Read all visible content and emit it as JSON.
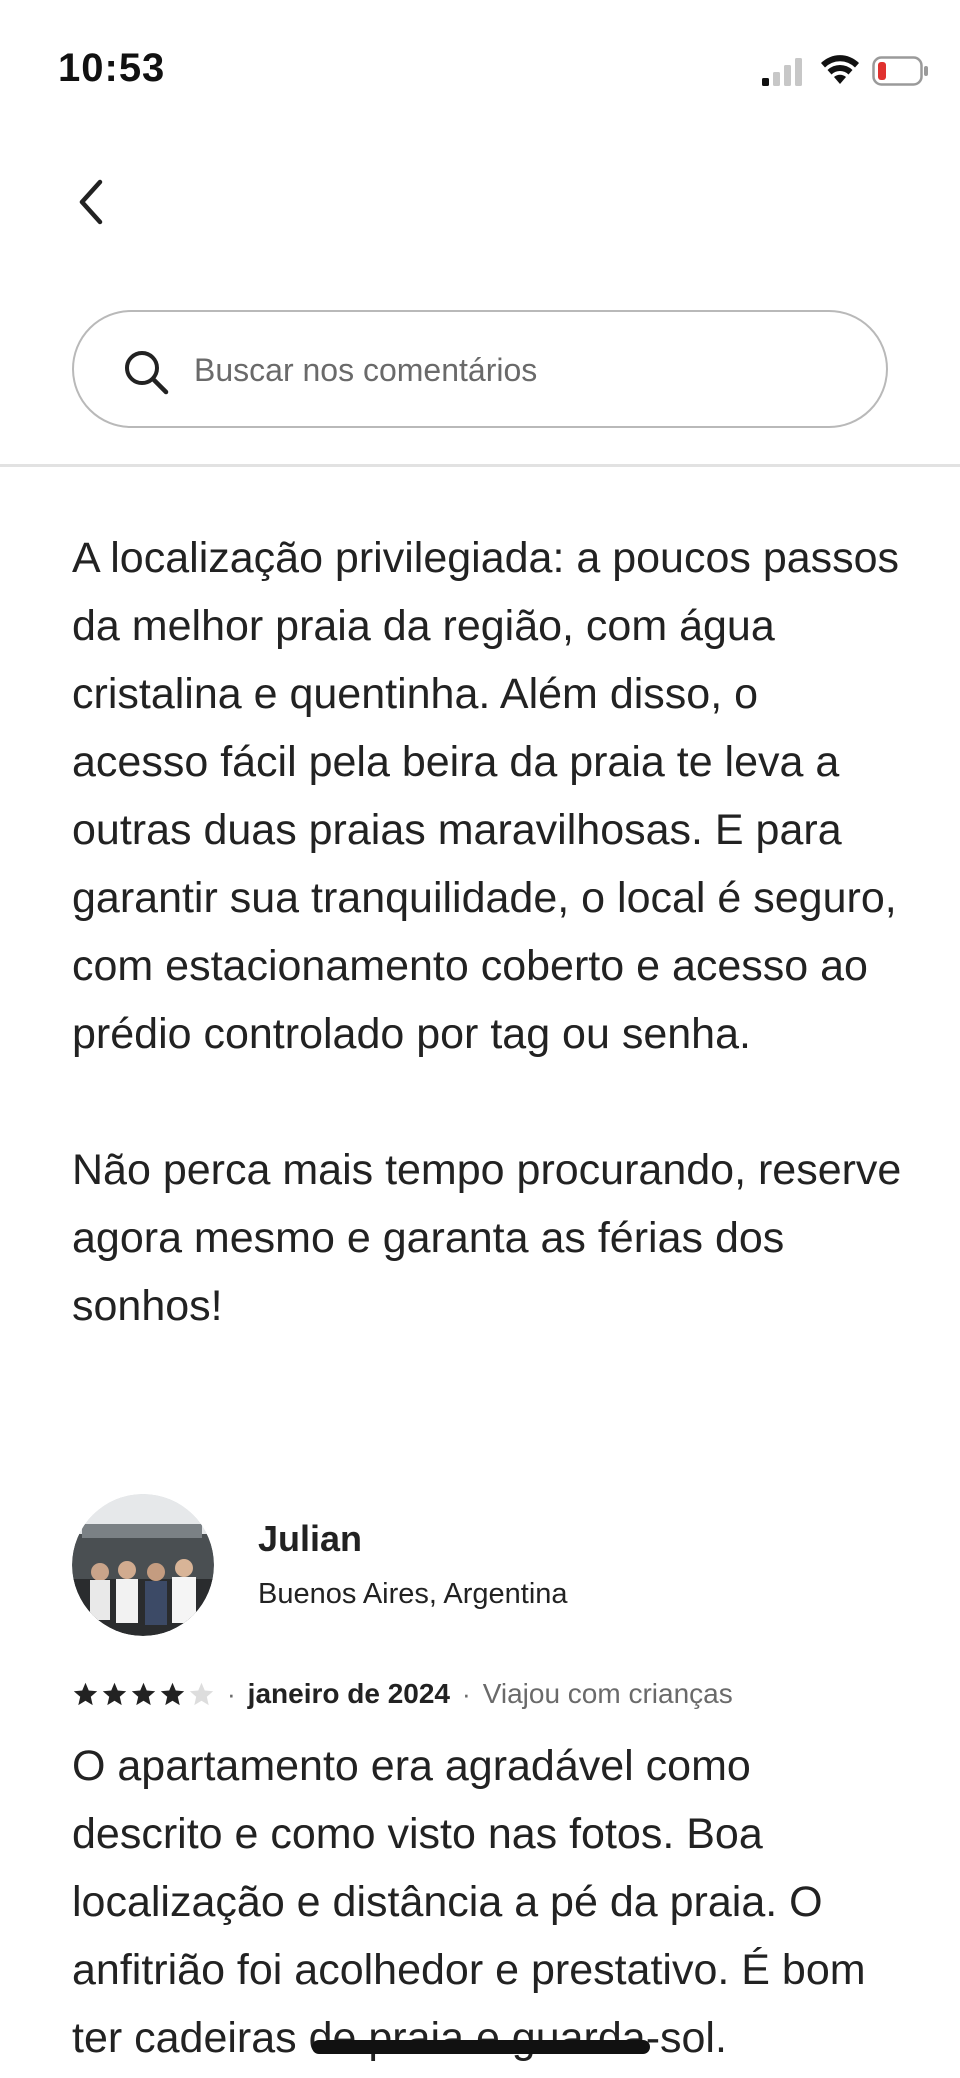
{
  "status_bar": {
    "time": "10:53",
    "battery_color": "#e0312f"
  },
  "nav": {
    "back_icon": "chevron-left-icon"
  },
  "search": {
    "icon": "search-icon",
    "placeholder": "Buscar nos comentários"
  },
  "listing_description": {
    "paragraphs": [
      "A localização privilegiada: a poucos passos da melhor praia da região, com água cristalina e quentinha. Além disso, o acesso fácil pela beira da praia te leva a outras duas praias maravilhosas. E para garantir sua tranquilidade, o local é seguro, com estacionamento coberto e acesso ao prédio controlado por tag ou senha.",
      "Não perca mais tempo procurando, reserve agora mesmo e garanta as férias dos sonhos!"
    ]
  },
  "review": {
    "reviewer_name": "Julian",
    "reviewer_location": "Buenos Aires, Argentina",
    "rating": 4,
    "rating_max": 5,
    "date": "janeiro de 2024",
    "trip_type": "Viajou com crianças",
    "text": "O apartamento era agradável como descrito e como visto nas fotos. Boa localização e distância a pé da praia. O anfitrião foi acolhedor e prestativo. É bom ter cadeiras de praia e guarda-sol."
  }
}
